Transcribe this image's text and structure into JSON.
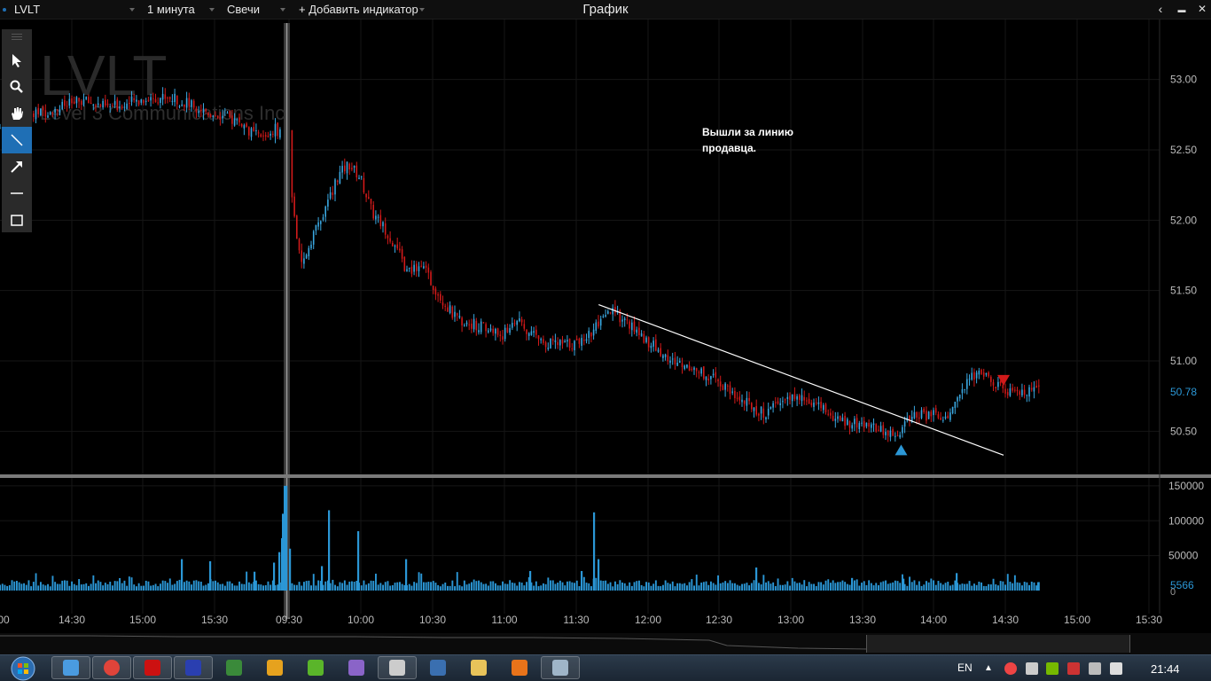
{
  "topbar": {
    "symbol": "LVLT",
    "interval": "1 минута",
    "chart_type": "Свечи",
    "add_indicator": "+ Добавить индикатор",
    "window_title": "График",
    "back_icon": "‹",
    "minimize_icon": "▬",
    "close_icon": "✕"
  },
  "toolbar": {
    "tools": [
      "menu-grip",
      "pointer",
      "zoom",
      "pan",
      "line",
      "arrow",
      "horizontal-line",
      "rectangle"
    ],
    "active": "line"
  },
  "watermark": {
    "symbol": "LVLT",
    "company": "Level 3 Communications Inc"
  },
  "annotation": {
    "line1": "Вышли за линию",
    "line2": "продавца."
  },
  "price_axis": {
    "labels": [
      "53.00",
      "52.50",
      "52.00",
      "51.50",
      "51.00",
      "50.50"
    ],
    "values": [
      53.0,
      52.5,
      52.0,
      51.5,
      51.0,
      50.5
    ],
    "last_price": "50.78",
    "last_price_value": 50.78
  },
  "volume_axis": {
    "labels": [
      "150000",
      "100000",
      "50000"
    ],
    "values": [
      150000,
      100000,
      50000
    ],
    "last_volume": "5566",
    "zero_label": "0"
  },
  "time_axis": {
    "labels": [
      "00",
      "14:30",
      "15:00",
      "15:30",
      "09:30",
      "10:00",
      "10:30",
      "11:00",
      "11:30",
      "12:00",
      "12:30",
      "13:00",
      "13:30",
      "14:00",
      "14:30",
      "15:00",
      "15:30"
    ]
  },
  "chart_data": {
    "type": "candlestick",
    "symbol": "LVLT",
    "interval": "1 минута",
    "ylim": [
      50.2,
      53.3
    ],
    "session_break": "09:30",
    "price_path": [
      [
        "13:59",
        52.65
      ],
      [
        "14:10",
        52.72
      ],
      [
        "14:20",
        52.78
      ],
      [
        "14:35",
        52.85
      ],
      [
        "14:45",
        52.8
      ],
      [
        "15:00",
        52.86
      ],
      [
        "15:10",
        52.88
      ],
      [
        "15:20",
        52.82
      ],
      [
        "15:30",
        52.75
      ],
      [
        "15:40",
        52.7
      ],
      [
        "15:45",
        52.62
      ],
      [
        "15:50",
        52.58
      ],
      [
        "15:55",
        52.65
      ],
      [
        "15:59",
        52.6
      ],
      [
        "09:31",
        52.2
      ],
      [
        "09:35",
        51.65
      ],
      [
        "09:40",
        51.9
      ],
      [
        "09:45",
        52.05
      ],
      [
        "09:50",
        52.3
      ],
      [
        "09:55",
        52.4
      ],
      [
        "10:00",
        52.3
      ],
      [
        "10:05",
        52.05
      ],
      [
        "10:10",
        51.95
      ],
      [
        "10:15",
        51.8
      ],
      [
        "10:20",
        51.62
      ],
      [
        "10:25",
        51.7
      ],
      [
        "10:30",
        51.55
      ],
      [
        "10:35",
        51.42
      ],
      [
        "10:40",
        51.3
      ],
      [
        "10:50",
        51.25
      ],
      [
        "11:00",
        51.18
      ],
      [
        "11:05",
        51.3
      ],
      [
        "11:10",
        51.2
      ],
      [
        "11:20",
        51.12
      ],
      [
        "11:30",
        51.12
      ],
      [
        "11:35",
        51.18
      ],
      [
        "11:40",
        51.25
      ],
      [
        "11:45",
        51.35
      ],
      [
        "11:50",
        51.3
      ],
      [
        "12:00",
        51.15
      ],
      [
        "12:10",
        51.0
      ],
      [
        "12:20",
        50.95
      ],
      [
        "12:30",
        50.85
      ],
      [
        "12:40",
        50.72
      ],
      [
        "12:50",
        50.62
      ],
      [
        "13:00",
        50.75
      ],
      [
        "13:10",
        50.7
      ],
      [
        "13:20",
        50.58
      ],
      [
        "13:30",
        50.55
      ],
      [
        "13:40",
        50.5
      ],
      [
        "13:45",
        50.45
      ],
      [
        "13:50",
        50.6
      ],
      [
        "14:00",
        50.62
      ],
      [
        "14:05",
        50.55
      ],
      [
        "14:10",
        50.7
      ],
      [
        "14:15",
        50.85
      ],
      [
        "14:20",
        50.95
      ],
      [
        "14:25",
        50.85
      ],
      [
        "14:30",
        50.8
      ],
      [
        "14:35",
        50.75
      ],
      [
        "14:40",
        50.78
      ]
    ],
    "volume_spikes": [
      [
        "09:30",
        150000
      ],
      [
        "09:50",
        115000
      ],
      [
        "10:00",
        85000
      ],
      [
        "11:35",
        112000
      ],
      [
        "10:20",
        45000
      ]
    ],
    "trendline": {
      "from": [
        "11:40",
        51.4
      ],
      "to": [
        "14:30",
        50.33
      ]
    },
    "buy_marker": {
      "time": "13:47",
      "price": 50.38
    },
    "sell_marker": {
      "time": "14:30",
      "price": 50.85
    }
  },
  "taskbar": {
    "apps": [
      "windows-explorer",
      "chrome",
      "opera",
      "trading-platform",
      "unknown-green",
      "avast",
      "utorrent",
      "visual-studio",
      "terminal",
      "pidgin",
      "folder",
      "firefox",
      "calculator"
    ],
    "language": "EN",
    "clock": "21:44"
  },
  "colors": {
    "up": "#3aa7e0",
    "down": "#d11a1a",
    "volume": "#2b97d6",
    "grid": "#161616",
    "active_tool": "#1f6fb5"
  }
}
